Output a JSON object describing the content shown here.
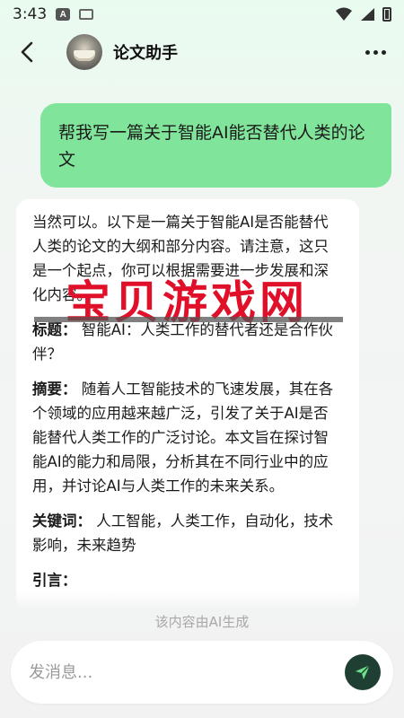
{
  "status_bar": {
    "time": "3:43",
    "notification_icon": "A"
  },
  "header": {
    "title": "论文助手"
  },
  "user_message": {
    "text": "帮我写一篇关于智能AI能否替代人类的论文"
  },
  "ai_message": {
    "intro": "当然可以。以下是一篇关于智能AI是否能替代人类的论文的大纲和部分内容。请注意，这只是一个起点，你可以根据需要进一步发展和深化内容。",
    "title_label": "标题：",
    "title_text": "智能AI：人类工作的替代者还是合作伙伴？",
    "abstract_label": "摘要：",
    "abstract_text": "随着人工智能技术的飞速发展，其在各个领域的应用越来越广泛，引发了关于AI是否能替代人类工作的广泛讨论。本文旨在探讨智能AI的能力和局限，分析其在不同行业中的应用，并讨论AI与人类工作的未来关系。",
    "keywords_label": "关键词：",
    "keywords_text": "人工智能，人类工作，自动化，技术影响，未来趋势",
    "next_label": "引言："
  },
  "watermark": {
    "text": "宝贝游戏网"
  },
  "ai_note": "该内容由AI生成",
  "input": {
    "placeholder": "发消息..."
  },
  "colors": {
    "user_bubble": "#80e59a",
    "send_button": "#1f3f33",
    "watermark": "#e0102a"
  }
}
